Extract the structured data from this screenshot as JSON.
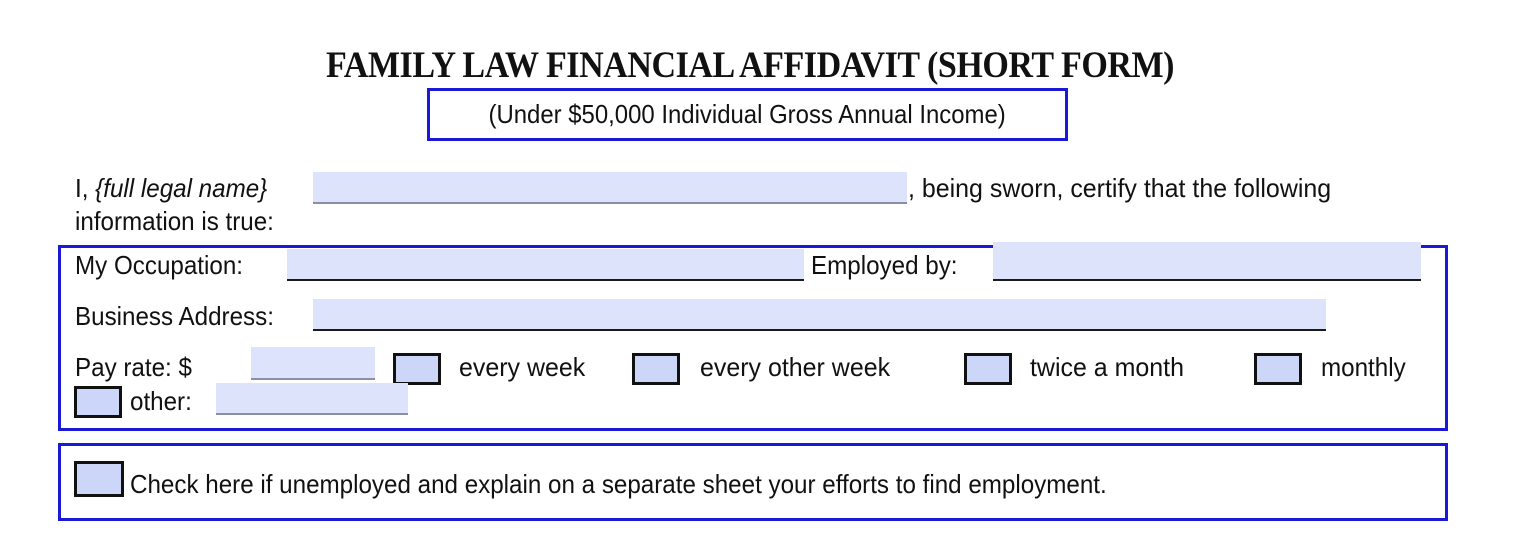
{
  "header": {
    "title": "FAMILY LAW FINANCIAL AFFIDAVIT (SHORT FORM)",
    "subtitle": "(Under $50,000 Individual Gross Annual Income)"
  },
  "oath": {
    "prefix": "I,",
    "name_hint": "{full legal name}",
    "name_value": "",
    "suffix": ", being sworn, certify that the following",
    "line2": "information is true:"
  },
  "employment": {
    "occupation_label": "My Occupation:",
    "occupation_value": "",
    "employer_label": "Employed by:",
    "employer_value": "",
    "address_label": "Business Address:",
    "address_value": "",
    "pay_rate_label": "Pay  rate:  $",
    "pay_rate_value": "",
    "frequency_options": [
      {
        "label": "every  week",
        "checked": false
      },
      {
        "label": "every  other  week",
        "checked": false
      },
      {
        "label": "twice  a  month",
        "checked": false
      },
      {
        "label": "monthly",
        "checked": false
      }
    ],
    "other_label": "other:",
    "other_checked": false,
    "other_value": ""
  },
  "unemployed": {
    "checked": false,
    "label": "Check here if unemployed and explain on a separate sheet your efforts to find employment."
  },
  "colors": {
    "box_border": "#1a1ad6",
    "field_fill": "#dde3fb",
    "checkbox_fill": "#ccd6f8"
  }
}
